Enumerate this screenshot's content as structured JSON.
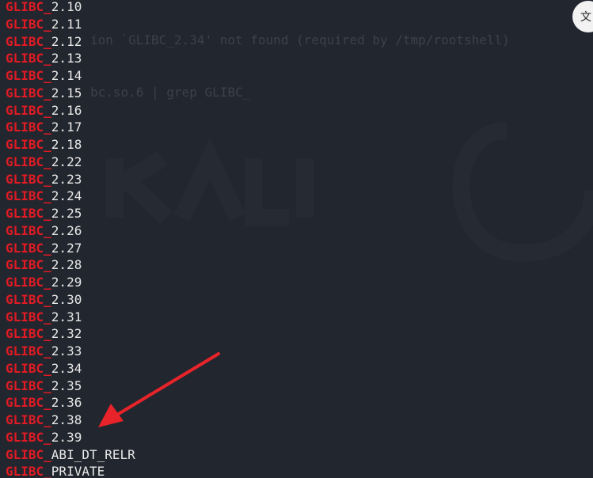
{
  "terminal": {
    "ghost_lines": [
      "           ion `GLIBC_2.34' not found (required by /tmp/rootshell)",
      "           bc.so.6 | grep GLIBC_"
    ],
    "search_term": "GLIBC_",
    "lines": [
      {
        "match": "GLIBC_",
        "rest": "2.10"
      },
      {
        "match": "GLIBC_",
        "rest": "2.11"
      },
      {
        "match": "GLIBC_",
        "rest": "2.12"
      },
      {
        "match": "GLIBC_",
        "rest": "2.13"
      },
      {
        "match": "GLIBC_",
        "rest": "2.14"
      },
      {
        "match": "GLIBC_",
        "rest": "2.15"
      },
      {
        "match": "GLIBC_",
        "rest": "2.16"
      },
      {
        "match": "GLIBC_",
        "rest": "2.17"
      },
      {
        "match": "GLIBC_",
        "rest": "2.18"
      },
      {
        "match": "GLIBC_",
        "rest": "2.22"
      },
      {
        "match": "GLIBC_",
        "rest": "2.23"
      },
      {
        "match": "GLIBC_",
        "rest": "2.24"
      },
      {
        "match": "GLIBC_",
        "rest": "2.25"
      },
      {
        "match": "GLIBC_",
        "rest": "2.26"
      },
      {
        "match": "GLIBC_",
        "rest": "2.27"
      },
      {
        "match": "GLIBC_",
        "rest": "2.28"
      },
      {
        "match": "GLIBC_",
        "rest": "2.29"
      },
      {
        "match": "GLIBC_",
        "rest": "2.30"
      },
      {
        "match": "GLIBC_",
        "rest": "2.31"
      },
      {
        "match": "GLIBC_",
        "rest": "2.32"
      },
      {
        "match": "GLIBC_",
        "rest": "2.33"
      },
      {
        "match": "GLIBC_",
        "rest": "2.34"
      },
      {
        "match": "GLIBC_",
        "rest": "2.35"
      },
      {
        "match": "GLIBC_",
        "rest": "2.36"
      },
      {
        "match": "GLIBC_",
        "rest": "2.38"
      },
      {
        "match": "GLIBC_",
        "rest": "2.39"
      },
      {
        "match": "GLIBC_",
        "rest": "ABI_DT_RELR"
      },
      {
        "match": "GLIBC_",
        "rest": "PRIVATE"
      }
    ]
  },
  "translate_button": {
    "icon": "translate-icon",
    "glyph": "文"
  },
  "annotation": {
    "icon": "red-arrow-icon",
    "points_to": "2.39"
  },
  "colors": {
    "background": "#22262e",
    "match": "#e01b24",
    "text": "#e8e8e8",
    "arrow": "#e8232a"
  }
}
